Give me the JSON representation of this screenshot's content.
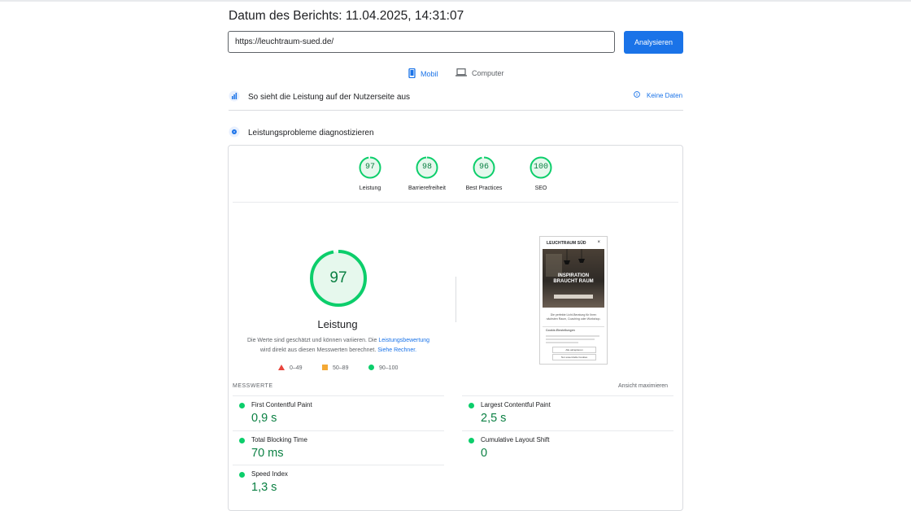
{
  "header": {
    "title": "Datum des Berichts: 11.04.2025, 14:31:07",
    "url_value": "https://leuchtraum-sued.de/",
    "analyze_label": "Analysieren"
  },
  "tabs": [
    {
      "label": "Mobil",
      "active": true
    },
    {
      "label": "Computer",
      "active": false
    }
  ],
  "field_section": {
    "title": "So sieht die Leistung auf der Nutzerseite aus",
    "no_data": "Keine Daten"
  },
  "diagnose_section": {
    "title": "Leistungsprobleme diagnostizieren"
  },
  "categories": [
    {
      "score": "97",
      "label": "Leistung"
    },
    {
      "score": "98",
      "label": "Barrierefreiheit"
    },
    {
      "score": "96",
      "label": "Best Practices"
    },
    {
      "score": "100",
      "label": "SEO"
    }
  ],
  "performance": {
    "score": "97",
    "title": "Leistung",
    "desc_1": "Die Werte sind geschätzt und können variieren. Die ",
    "desc_link_1": "Leistungsbewertung",
    "desc_2": "wird direkt aus diesen Messwerten berechnet. ",
    "desc_link_2": "Siehe Rechner."
  },
  "legend": [
    {
      "label": "0–49",
      "color": "#e8453c"
    },
    {
      "label": "50–89",
      "color": "#f4a935"
    },
    {
      "label": "90–100",
      "color": "#0cce6b"
    }
  ],
  "screenshot": {
    "brand": "LEUCHTRAUM SÜD",
    "hero_line1": "INSPIRATION",
    "hero_line2": "BRAUCHT RAUM",
    "teaser": "Die perfekte Licht-Beratung für Ihren nächsten Raum, Coaching oder Workshop.",
    "cookie_title": "Cookie-Einstellungen",
    "btn_1": "Alle akzeptieren",
    "btn_2": "Nur essenzielle Cookies"
  },
  "metrics": {
    "label": "MESSWERTE",
    "expand": "Ansicht maximieren",
    "items": [
      {
        "name": "First Contentful Paint",
        "value": "0,9 s"
      },
      {
        "name": "Largest Contentful Paint",
        "value": "2,5 s"
      },
      {
        "name": "Total Blocking Time",
        "value": "70 ms"
      },
      {
        "name": "Cumulative Layout Shift",
        "value": "0"
      },
      {
        "name": "Speed Index",
        "value": "1,3 s"
      }
    ]
  },
  "colors": {
    "accent": "#1a73e8",
    "good": "#0cce6b",
    "good_text": "#0b8043"
  }
}
